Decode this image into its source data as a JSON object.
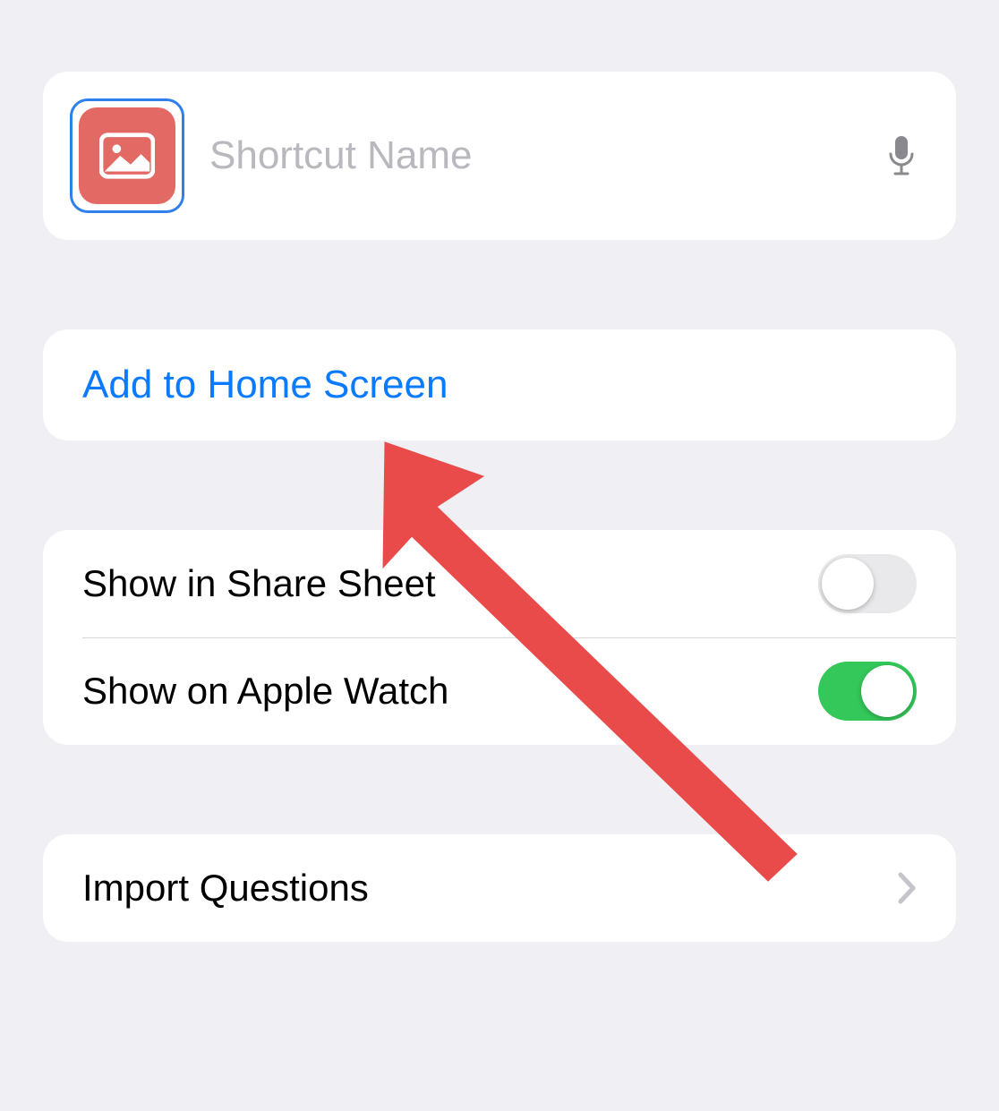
{
  "nameSection": {
    "placeholder": "Shortcut Name",
    "value": ""
  },
  "actions": {
    "addToHomeScreen": "Add to Home Screen"
  },
  "toggles": {
    "shareSheet": {
      "label": "Show in Share Sheet",
      "on": false
    },
    "appleWatch": {
      "label": "Show on Apple Watch",
      "on": true
    }
  },
  "importQuestions": {
    "label": "Import Questions"
  },
  "colors": {
    "link": "#0a7aff",
    "iconBg": "#e36a64",
    "toggleOn": "#34c759",
    "arrow": "#e74c3c"
  }
}
